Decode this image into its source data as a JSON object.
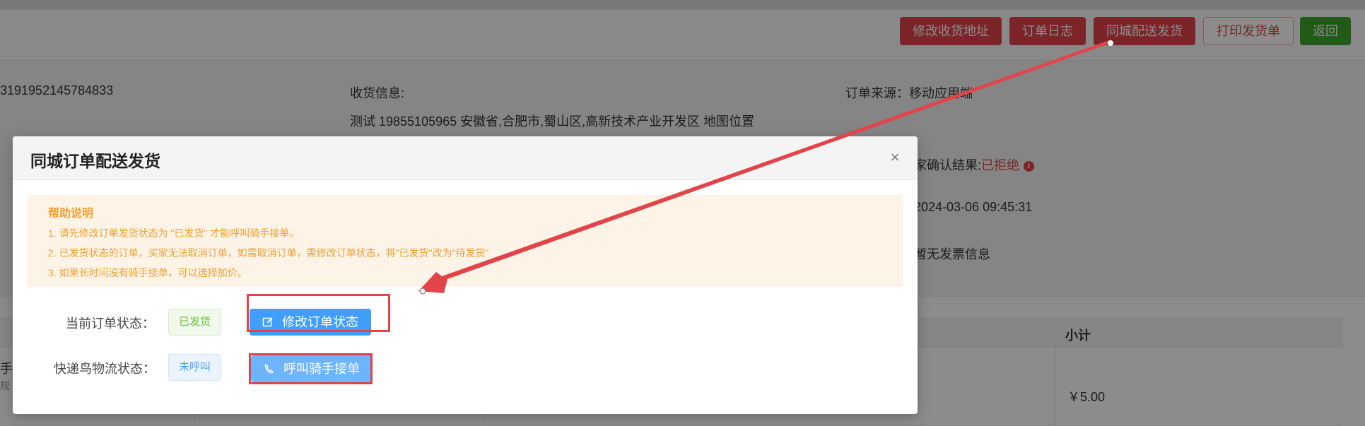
{
  "toolbar": {
    "edit_address": "修改收货地址",
    "order_log": "订单日志",
    "city_delivery": "同城配送发货",
    "print_invoice": "打印发货单",
    "back": "返回"
  },
  "order_info": {
    "order_no_partial": "3191952145784833",
    "receiver_label": "收货信息:",
    "receiver_detail": "测试 19855105965 安徽省,合肥市,蜀山区,高新技术产业开发区 地图位置",
    "source": "订单来源：移动应用端",
    "confirm_result_label": "家确认结果:",
    "confirm_result_value": "已拒绝",
    "confirm_time": "2024-03-06 09:45:31",
    "invoice": "暂无发票信息"
  },
  "table": {
    "subtotal_header": "小计",
    "row_partial_1": "手",
    "row_partial_2": "规",
    "row_subtotal": "￥5.00"
  },
  "dialog": {
    "title": "同城订单配送发货",
    "close": "×",
    "help": {
      "title": "帮助说明",
      "line1": "1. 请先修改订单发货状态为 \"已发货\" 才能呼叫骑手接单。",
      "line2": "2. 已发货状态的订单，买家无法取消订单，如需取消订单，需修改订单状态，将\"已发货\"改为\"待发货\"",
      "line3": "3. 如果长时间没有骑手接单，可以选择加价。"
    },
    "order_status_label": "当前订单状态：",
    "order_status_value": "已发货",
    "edit_status_button": "修改订单状态",
    "logistics_label": "快递鸟物流状态：",
    "logistics_value": "未呼叫",
    "call_rider_button": "呼叫骑手接单"
  },
  "colors": {
    "danger": "#e2444a",
    "success": "#3fa72b",
    "primary": "#409eff",
    "warning_text": "#f0a030",
    "annotation": "#e2444a"
  },
  "icons": {
    "edit": "edit-icon",
    "phone": "phone-icon",
    "close": "close-icon",
    "info": "info-icon"
  }
}
